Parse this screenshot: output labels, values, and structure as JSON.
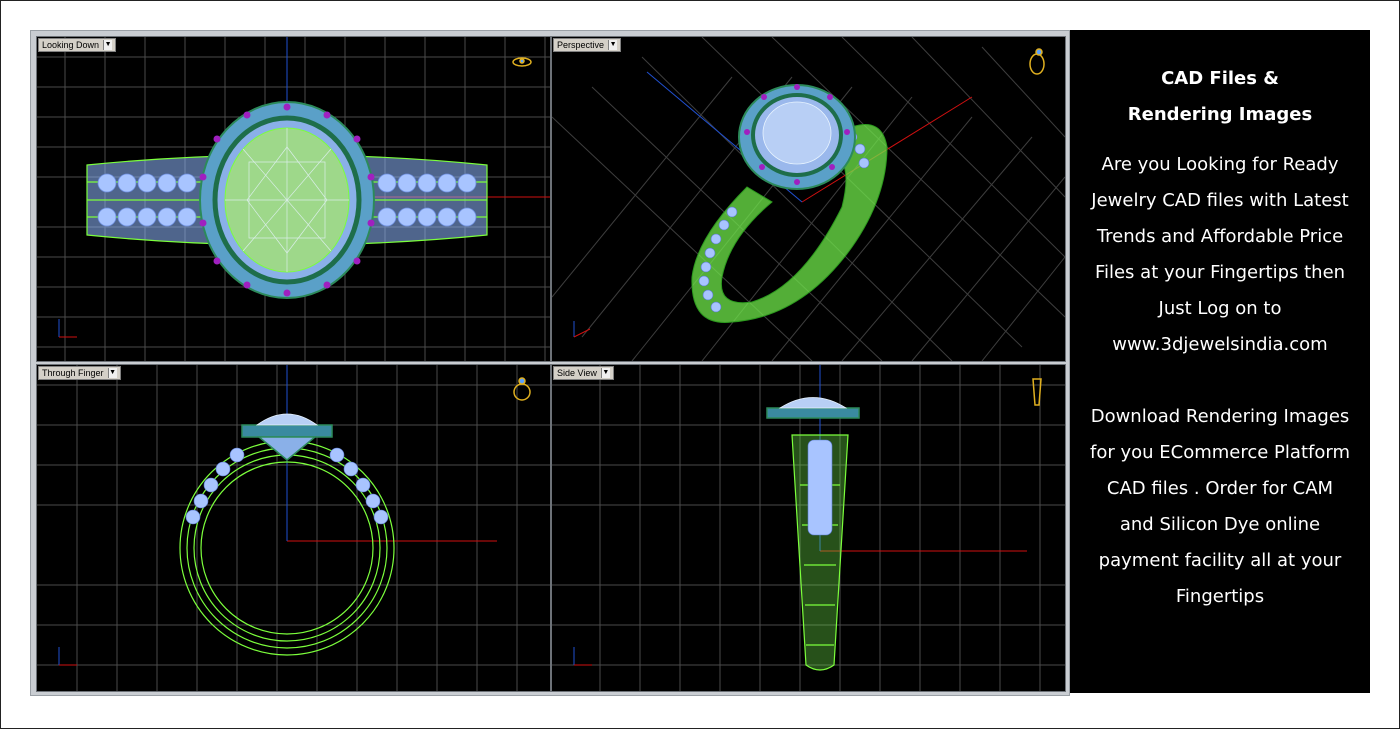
{
  "viewports": [
    {
      "id": "tl",
      "label": "Looking Down"
    },
    {
      "id": "tr",
      "label": "Perspective"
    },
    {
      "id": "bl",
      "label": "Through Finger"
    },
    {
      "id": "br",
      "label": "Side View"
    }
  ],
  "dropdown_glyph": "▼",
  "panel": {
    "title_line1": "CAD Files &",
    "title_line2": "Rendering Images",
    "paragraph1": "Are you Looking for Ready Jewelry CAD files with Latest Trends and Affordable Price Files at your Fingertips then Just Log on to www.3djewelsindia.com",
    "paragraph2": "Download Rendering Images for you ECommerce Platform CAD files . Order for CAM and Silicon Dye online payment facility all at your Fingertips"
  },
  "colors": {
    "wire_green": "#7cff3c",
    "stone_blue": "#a8c4ff",
    "accent_purple": "#a020c0",
    "grid": "#5a5a5a",
    "axis_red": "#d01010",
    "axis_blue": "#2050d0",
    "gold_icon": "#e0b020",
    "panel_bg": "#000000",
    "window_bg": "#c9cdd2"
  },
  "icons": [
    "ring-thumbnail-icon",
    "axis-gizmo-icon",
    "dropdown-arrow-icon"
  ]
}
